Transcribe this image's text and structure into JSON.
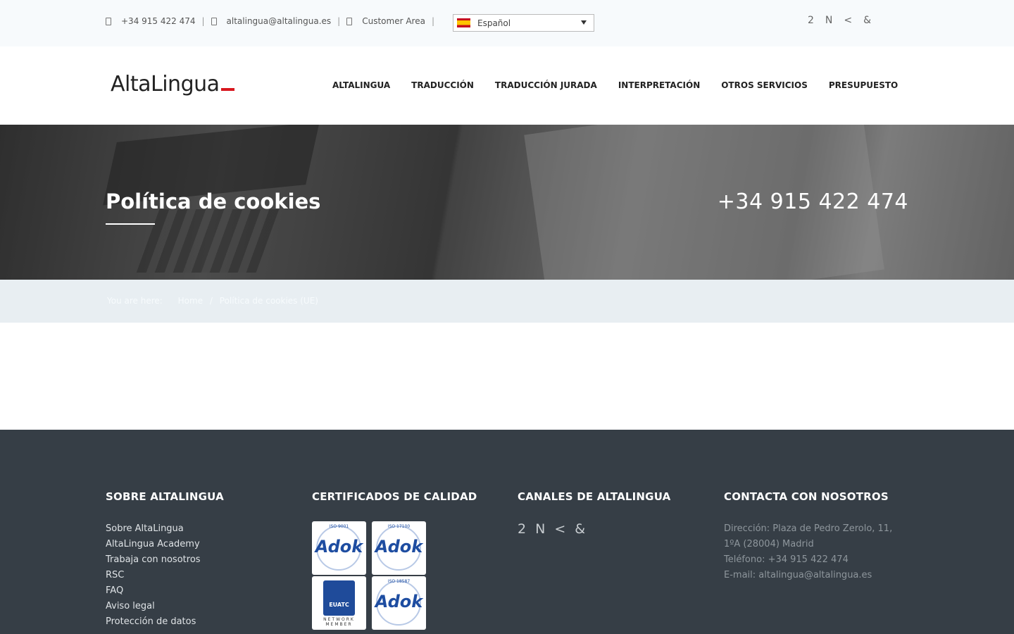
{
  "topbar": {
    "phone": "+34 915 422 474",
    "email": "altalingua@altalingua.es",
    "customer_area": "Customer Area",
    "separator": "|",
    "language": "Español",
    "social": [
      "2",
      "N",
      "<",
      "&"
    ]
  },
  "header": {
    "logo_text": "AltaLingua",
    "nav": [
      "ALTALINGUA",
      "TRADUCCIÓN",
      "TRADUCCIÓN JURADA",
      "INTERPRETACIÓN",
      "OTROS SERVICIOS",
      "PRESUPUESTO"
    ]
  },
  "hero": {
    "title": "Política de cookies",
    "phone": "+34 915 422 474"
  },
  "breadcrumb": {
    "you_are_here": "You are here:",
    "home": "Home",
    "separator": "/",
    "current": "Política de cookies (UE)"
  },
  "footer": {
    "about": {
      "heading": "SOBRE ALTALINGUA",
      "links": [
        "Sobre AltaLingua",
        "AltaLingua Academy",
        "Trabaja con nosotros",
        "RSC",
        "FAQ",
        "Aviso legal",
        "Protección de datos"
      ]
    },
    "certificates": {
      "heading": "CERTIFICADOS DE CALIDAD",
      "items": [
        {
          "iso": "ISO 9001",
          "mark": "Adok"
        },
        {
          "iso": "ISO 17100",
          "mark": "Adok"
        },
        {
          "badge": "EUATC",
          "subtitle": "NETWORK MEMBER"
        },
        {
          "iso": "ISO 18587",
          "mark": "Adok"
        }
      ]
    },
    "channels": {
      "heading": "CANALES DE ALTALINGUA",
      "social": [
        "2",
        "N",
        "<",
        "&"
      ]
    },
    "contact": {
      "heading": "CONTACTA CON NOSOTROS",
      "lines": [
        "Dirección: Plaza de Pedro Zerolo, 11,",
        "1ºA (28004) Madrid",
        "Teléfono: +34 915 422 474",
        "E-mail: altalingua@altalingua.es"
      ]
    }
  },
  "colors": {
    "accent_red": "#d8171e",
    "footer_bg": "#363e46",
    "breadcrumb_bg": "#e8eef2",
    "topbar_bg": "#f7fafc"
  }
}
